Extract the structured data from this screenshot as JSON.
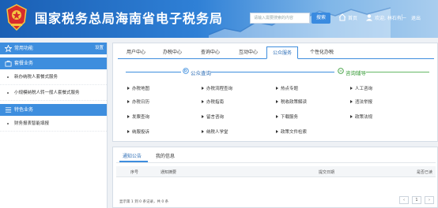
{
  "header": {
    "title": "国家税务总局海南省电子税务局",
    "search_placeholder": "请输入需要搜索的内容",
    "search_button": "搜索",
    "home_label": "首页",
    "user_label": "欢迎, 林石有一",
    "logout_label": "退出"
  },
  "sidebar": {
    "common": {
      "title": "常用功能",
      "settings": "设置"
    },
    "package": {
      "title": "套餐业务",
      "items": [
        "新办纳税人套餐式服务",
        "小规模纳税人转一般人套餐式服务"
      ]
    },
    "special": {
      "title": "特色业务",
      "items": [
        "财务报表智能填报"
      ]
    }
  },
  "tabs": [
    "用户中心",
    "办税中心",
    "查询中心",
    "互动中心",
    "公众服务",
    "个性化办税"
  ],
  "active_tab": "公众服务",
  "public_query": {
    "title": "公众查询",
    "links": [
      "办税地图",
      "办税日历",
      "发票查询",
      "纳服投诉",
      "办税流程查询",
      "办税指南",
      "留言咨询",
      "纳税人学堂"
    ]
  },
  "consult": {
    "title": "咨询辅导",
    "links": [
      "热点专题",
      "税收政策解读",
      "下载服务",
      "政策文件检索",
      "人工咨询",
      "违法举报",
      "政策法规"
    ]
  },
  "bottom": {
    "tabs": [
      "通知公告",
      "我的信息"
    ],
    "columns": [
      "序号",
      "通知摘要",
      "提交日期",
      "是否已读"
    ],
    "footer": "显示第 1 到 0 条记录，共 0 条",
    "page": "1"
  },
  "colors": {
    "accent": "#3e8ede",
    "green": "#3a9d3a"
  }
}
